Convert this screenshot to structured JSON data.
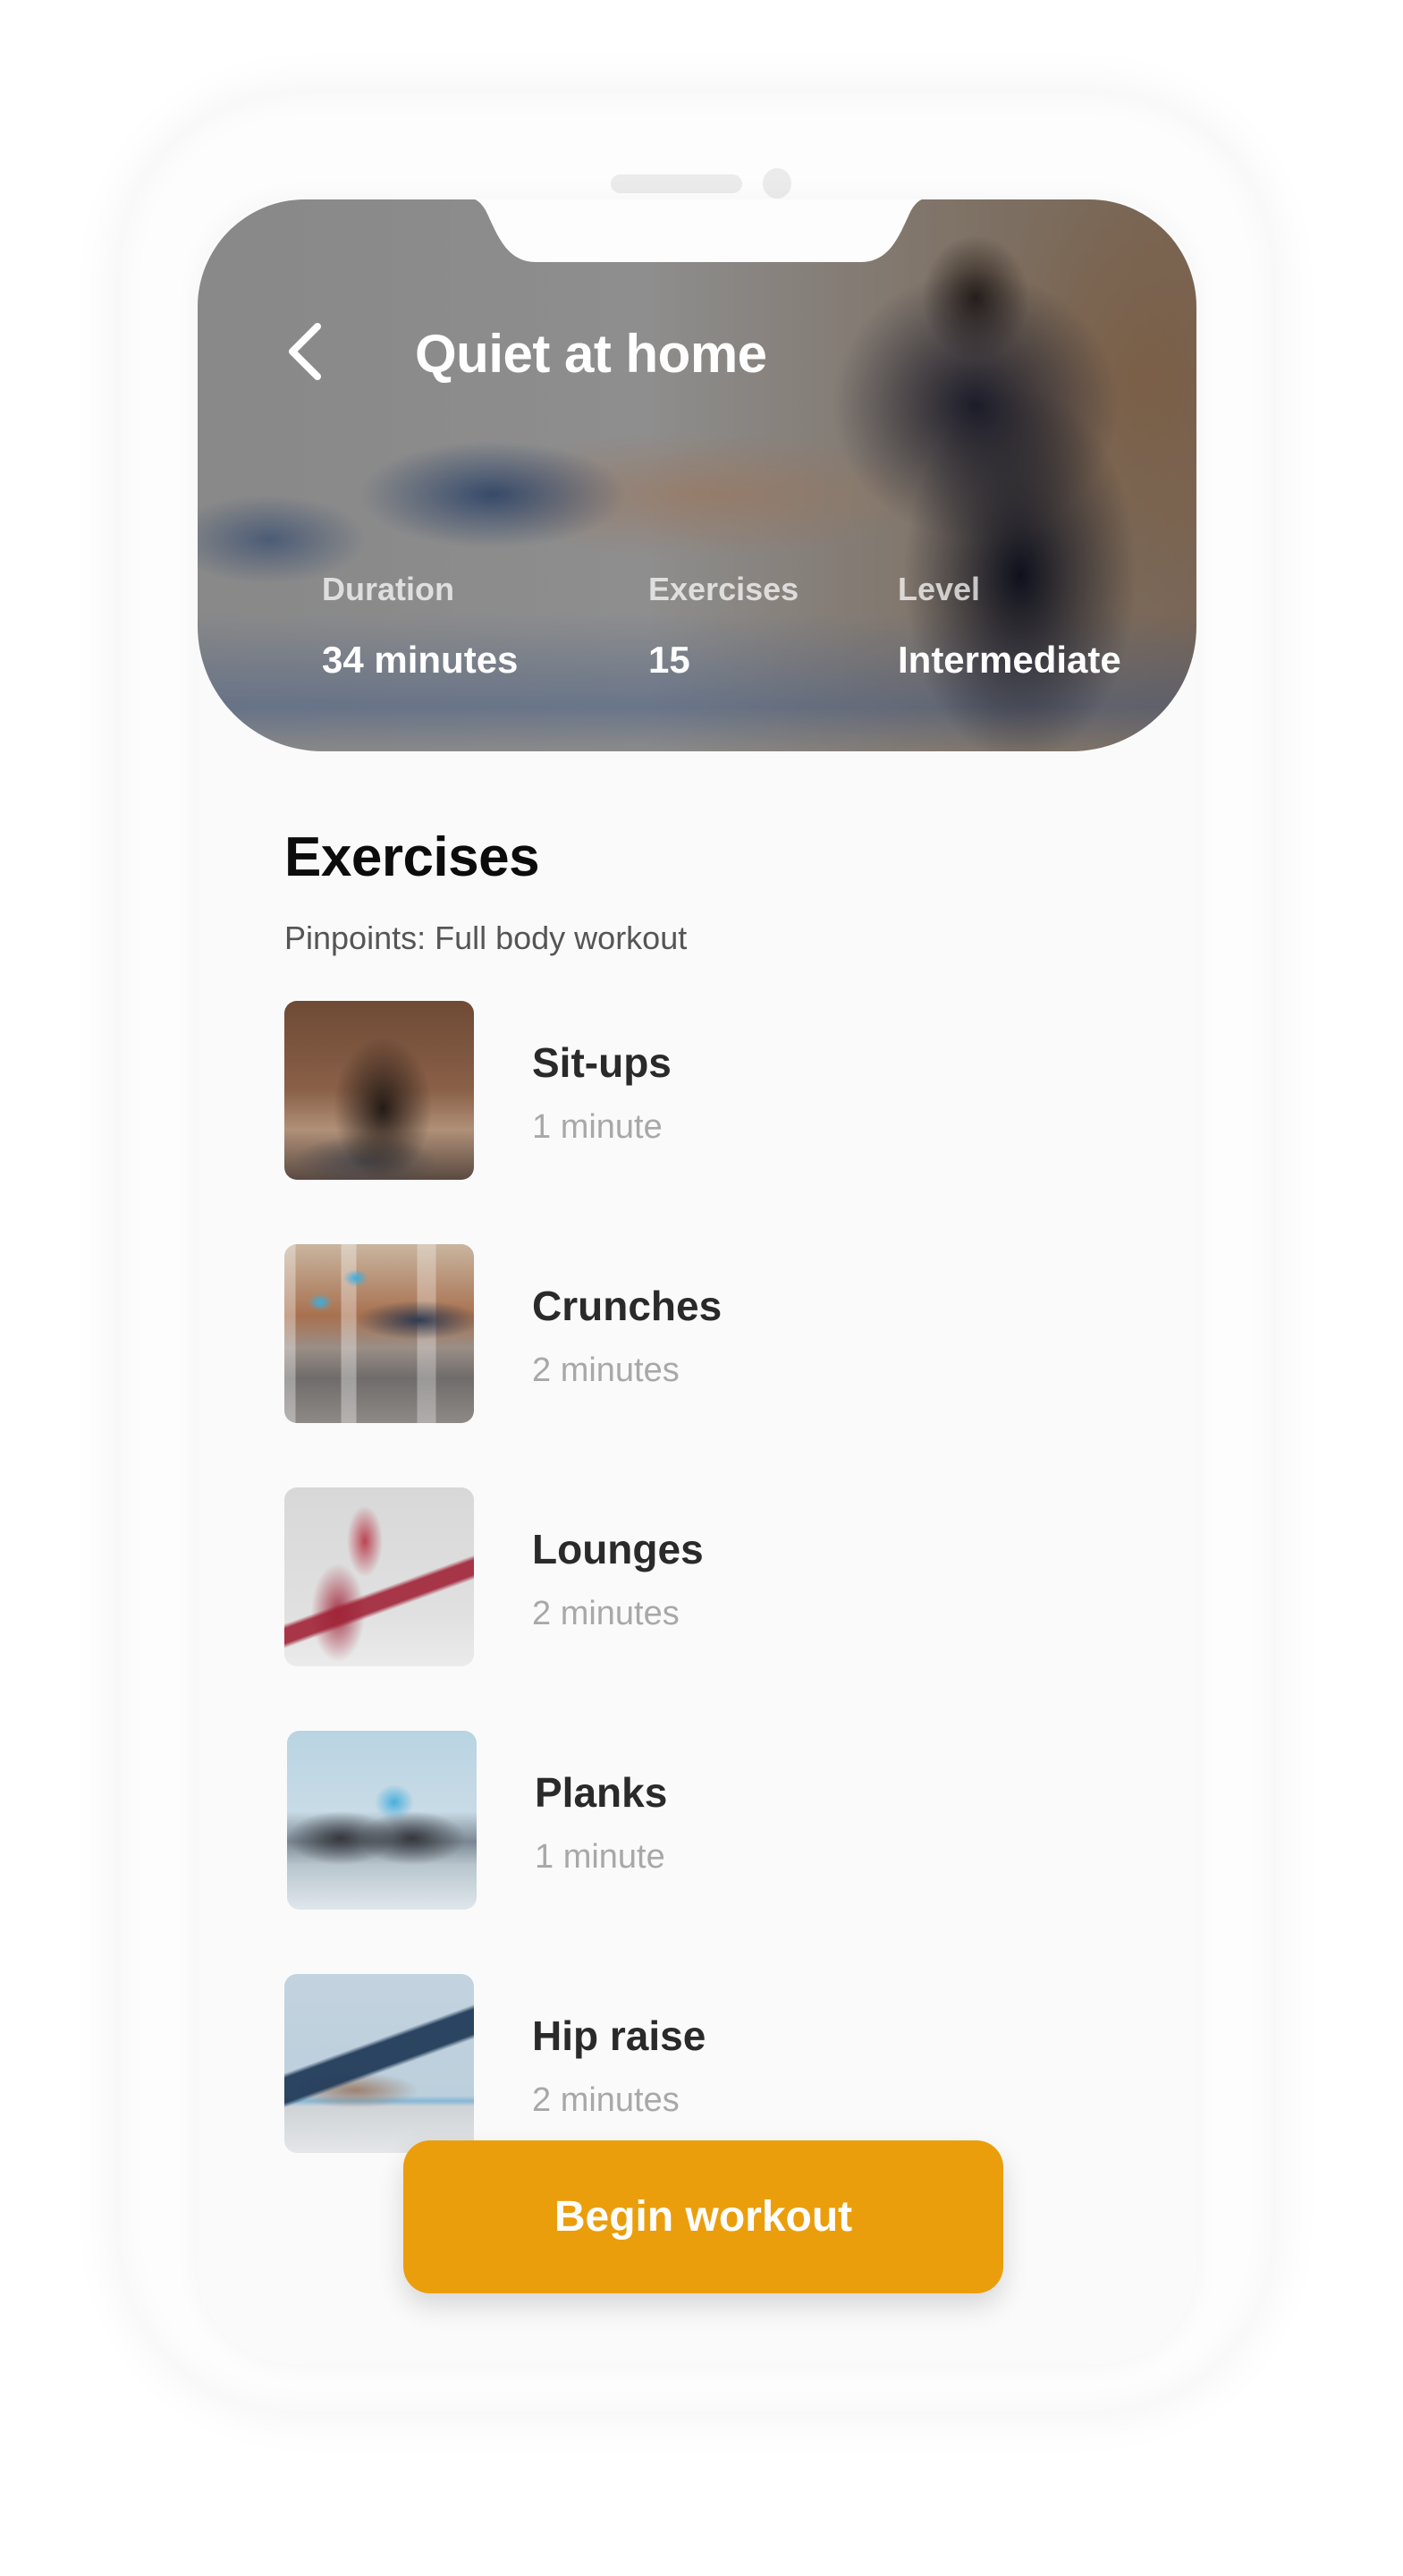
{
  "header": {
    "title": "Quiet at home",
    "back_icon": "chevron-left-icon"
  },
  "stats": [
    {
      "label": "Duration",
      "value": "34 minutes"
    },
    {
      "label": "Exercises",
      "value": "15"
    },
    {
      "label": "Level",
      "value": "Intermediate"
    }
  ],
  "section": {
    "title": "Exercises",
    "subtitle": "Pinpoints: Full body workout"
  },
  "exercises": [
    {
      "name": "Sit-ups",
      "duration": "1 minute",
      "image": "sit-ups-photo"
    },
    {
      "name": "Crunches",
      "duration": "2 minutes",
      "image": "crunches-photo"
    },
    {
      "name": "Lounges",
      "duration": "2 minutes",
      "image": "lunges-photo"
    },
    {
      "name": "Planks",
      "duration": "1 minute",
      "image": "planks-photo"
    },
    {
      "name": "Hip raise",
      "duration": "2 minutes",
      "image": "hip-raise-photo"
    }
  ],
  "actions": {
    "begin_label": "Begin workout"
  },
  "colors": {
    "accent": "#eb9e0c",
    "background": "#fafafa",
    "title_text": "#0c0c0c",
    "muted_text": "#a8a8a8"
  }
}
